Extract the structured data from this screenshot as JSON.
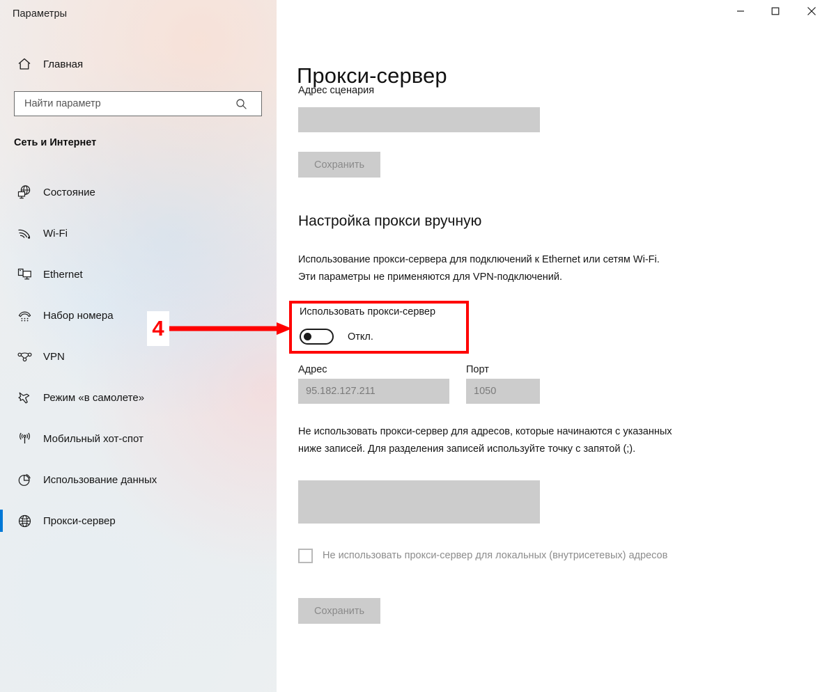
{
  "window": {
    "title": "Параметры",
    "controls": {
      "minimize": "minimize-icon",
      "maximize": "maximize-icon",
      "close": "close-icon"
    }
  },
  "sidebar": {
    "home": {
      "label": "Главная",
      "icon": "home-icon"
    },
    "search": {
      "placeholder": "Найти параметр",
      "value": "",
      "icon": "search-icon"
    },
    "group_title": "Сеть и Интернет",
    "items": [
      {
        "label": "Состояние",
        "icon": "status-globe-icon",
        "selected": false
      },
      {
        "label": "Wi-Fi",
        "icon": "wifi-icon",
        "selected": false
      },
      {
        "label": "Ethernet",
        "icon": "ethernet-icon",
        "selected": false
      },
      {
        "label": "Набор номера",
        "icon": "dialup-phone-icon",
        "selected": false
      },
      {
        "label": "VPN",
        "icon": "vpn-icon",
        "selected": false
      },
      {
        "label": "Режим «в самолете»",
        "icon": "airplane-icon",
        "selected": false
      },
      {
        "label": "Мобильный хот-спот",
        "icon": "hotspot-icon",
        "selected": false
      },
      {
        "label": "Использование данных",
        "icon": "data-usage-pie-icon",
        "selected": false
      },
      {
        "label": "Прокси-сервер",
        "icon": "proxy-globe-icon",
        "selected": true
      }
    ]
  },
  "main": {
    "title": "Прокси-сервер",
    "script_address": {
      "label": "Адрес сценария",
      "value": "",
      "placeholder": "",
      "save_label": "Сохранить"
    },
    "manual": {
      "heading": "Настройка прокси вручную",
      "description": "Использование прокси-сервера для подключений к Ethernet или сетям Wi-Fi. Эти параметры не применяются для VPN-подключений.",
      "toggle": {
        "label": "Использовать прокси-сервер",
        "state_text": "Откл.",
        "checked": false
      },
      "address": {
        "label": "Адрес",
        "value": "95.182.127.211"
      },
      "port": {
        "label": "Порт",
        "value": "1050"
      },
      "exceptions": {
        "description": "Не использовать прокси-сервер для адресов, которые начинаются с указанных ниже записей. Для разделения записей используйте точку с запятой (;).",
        "value": "",
        "placeholder": ""
      },
      "bypass_local": {
        "label": "Не использовать прокси-сервер для локальных (внутрисетевых) адресов",
        "checked": false
      },
      "save_label": "Сохранить"
    }
  },
  "annotation": {
    "step_number": "4",
    "arrow": "right-arrow",
    "color": "#ff0000"
  },
  "colors": {
    "accent": "#0078d7",
    "disabled_field": "#cccccc",
    "disabled_text": "#8a8a8a",
    "annotation": "#ff0000"
  }
}
